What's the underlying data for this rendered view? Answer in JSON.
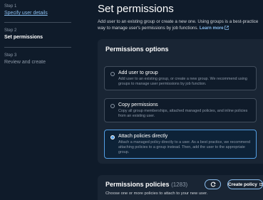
{
  "steps": [
    {
      "num": "Step 1",
      "title": "Specify user details"
    },
    {
      "num": "Step 2",
      "title": "Set permissions"
    },
    {
      "num": "Step 3",
      "title": "Review and create"
    }
  ],
  "page": {
    "title": "Set permissions",
    "description_line": "Add user to an existing group or create a new one. Using groups is a best-practice way to manage user's permissions by job functions.",
    "learn_more": "Learn more"
  },
  "permissions_options": {
    "title": "Permissions options",
    "options": [
      {
        "label": "Add user to group",
        "description": "Add user to an existing group, or create a new group. We recommend using groups to manage user permissions by job function.",
        "selected": false
      },
      {
        "label": "Copy permissions",
        "description": "Copy all group memberships, attached managed policies, and inline policies from an existing user.",
        "selected": false
      },
      {
        "label": "Attach policies directly",
        "description": "Attach a managed policy directly to a user. As a best practice, we recommend attaching policies to a group instead. Then, add the user to the appropriate group.",
        "selected": true
      }
    ]
  },
  "permissions_policies": {
    "title": "Permissions policies",
    "count": "(1283)",
    "subtitle": "Choose one or more policies to attach to your new user.",
    "refresh_icon": "refresh-icon",
    "create_label": "Create policy",
    "create_icon": "external-link-icon"
  },
  "colors": {
    "background": "#0f1b2a",
    "panel": "#192534",
    "accent": "#539fe5",
    "link": "#89bdee"
  }
}
